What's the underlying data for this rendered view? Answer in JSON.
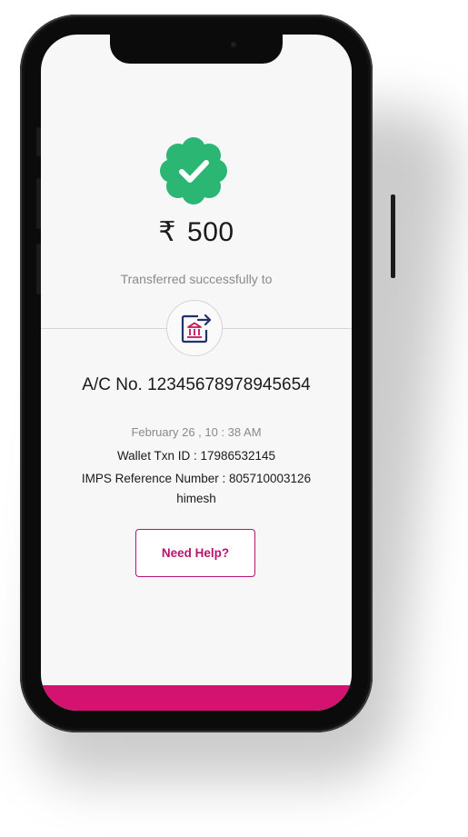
{
  "transfer": {
    "currency_symbol": "₹",
    "amount": "500",
    "status_text": "Transferred successfully to",
    "account_number": "A/C No. 12345678978945654",
    "datetime": "February 26 , 10 : 38 AM",
    "wallet_txn": "Wallet Txn ID : 17986532145",
    "imps_ref": "IMPS Reference Number : 805710003126",
    "beneficiary_name": "himesh"
  },
  "actions": {
    "help_label": "Need Help?"
  },
  "icons": {
    "success": "verified-check-badge-icon",
    "bank": "bank-transfer-icon"
  },
  "colors": {
    "success_green": "#2bb673",
    "accent_pink": "#d3136f",
    "button_pink": "#b8146e",
    "bank_icon_navy": "#22336b"
  }
}
